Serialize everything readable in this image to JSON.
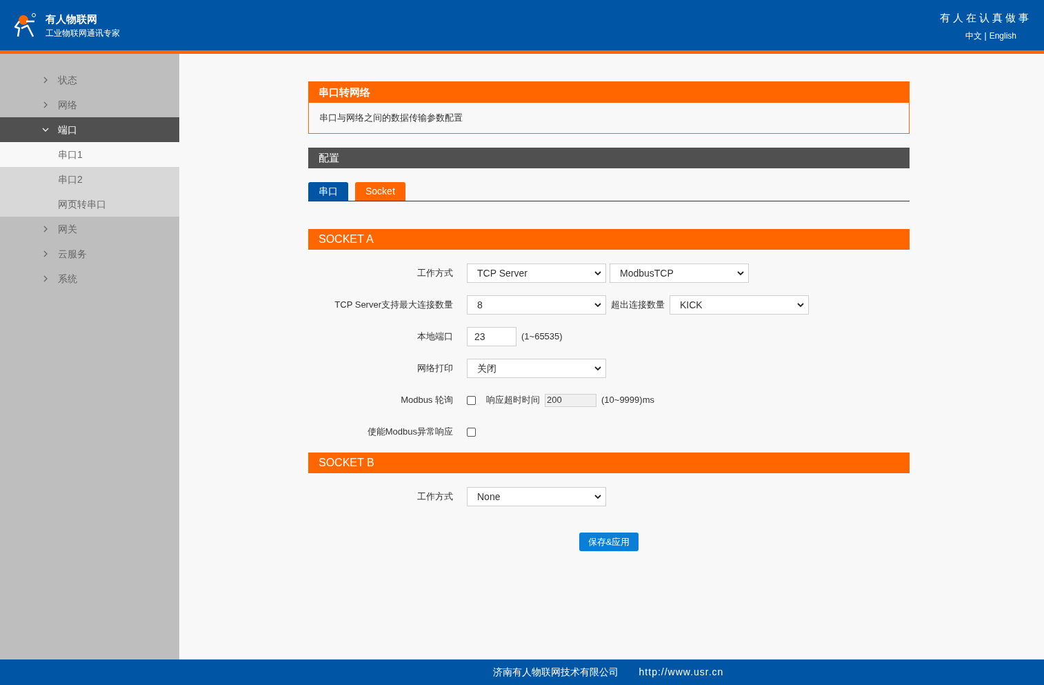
{
  "header": {
    "brand": "有人物联网",
    "subtitle": "工业物联网通讯专家",
    "slogan": "有人在认真做事",
    "languages": [
      {
        "label": "中文"
      },
      {
        "label": "English"
      }
    ],
    "separator": "|"
  },
  "sidebar": {
    "items": [
      {
        "label": "状态",
        "expanded": false
      },
      {
        "label": "网络",
        "expanded": false
      },
      {
        "label": "端口",
        "expanded": true,
        "children": [
          {
            "label": "串口1",
            "selected": true
          },
          {
            "label": "串口2",
            "selected": false
          },
          {
            "label": "网页转串口",
            "selected": false
          }
        ]
      },
      {
        "label": "网关",
        "expanded": false
      },
      {
        "label": "云服务",
        "expanded": false
      },
      {
        "label": "系统",
        "expanded": false
      }
    ]
  },
  "intro": {
    "title": "串口转网络",
    "description": "串口与网络之间的数据传输参数配置"
  },
  "config": {
    "title": "配置",
    "tabs": [
      {
        "label": "串口",
        "selected": false
      },
      {
        "label": "Socket",
        "selected": true
      }
    ]
  },
  "sections": [
    {
      "title": "SOCKET A",
      "rows": [
        {
          "label": "工作方式",
          "controls": [
            {
              "kind": "select",
              "value": "TCP Server"
            },
            {
              "kind": "select",
              "value": "ModbusTCP"
            }
          ]
        },
        {
          "label": "TCP Server支持最大连接数量",
          "controls": [
            {
              "kind": "select",
              "value": "8"
            },
            {
              "kind": "text",
              "value": "超出连接数量"
            },
            {
              "kind": "select",
              "value": "KICK"
            }
          ]
        },
        {
          "label": "本地端口",
          "controls": [
            {
              "kind": "input",
              "value": "23"
            },
            {
              "kind": "text",
              "value": "(1~65535)"
            }
          ]
        },
        {
          "label": "网络打印",
          "controls": [
            {
              "kind": "select",
              "value": "关闭"
            }
          ]
        },
        {
          "label": "Modbus 轮询",
          "controls": [
            {
              "kind": "checkbox",
              "checked": false
            },
            {
              "kind": "text",
              "value": "响应超时时间"
            },
            {
              "kind": "small-input",
              "value": "200"
            },
            {
              "kind": "text",
              "value": "(10~9999)ms"
            }
          ]
        },
        {
          "label": "使能Modbus异常响应",
          "controls": [
            {
              "kind": "checkbox",
              "checked": false
            }
          ]
        }
      ]
    },
    {
      "title": "SOCKET B",
      "rows": [
        {
          "label": "工作方式",
          "controls": [
            {
              "kind": "select",
              "value": "None"
            }
          ]
        }
      ]
    }
  ],
  "save_button": "保存&应用",
  "footer": {
    "company": "济南有人物联网技术有限公司",
    "url": "http://www.usr.cn"
  }
}
